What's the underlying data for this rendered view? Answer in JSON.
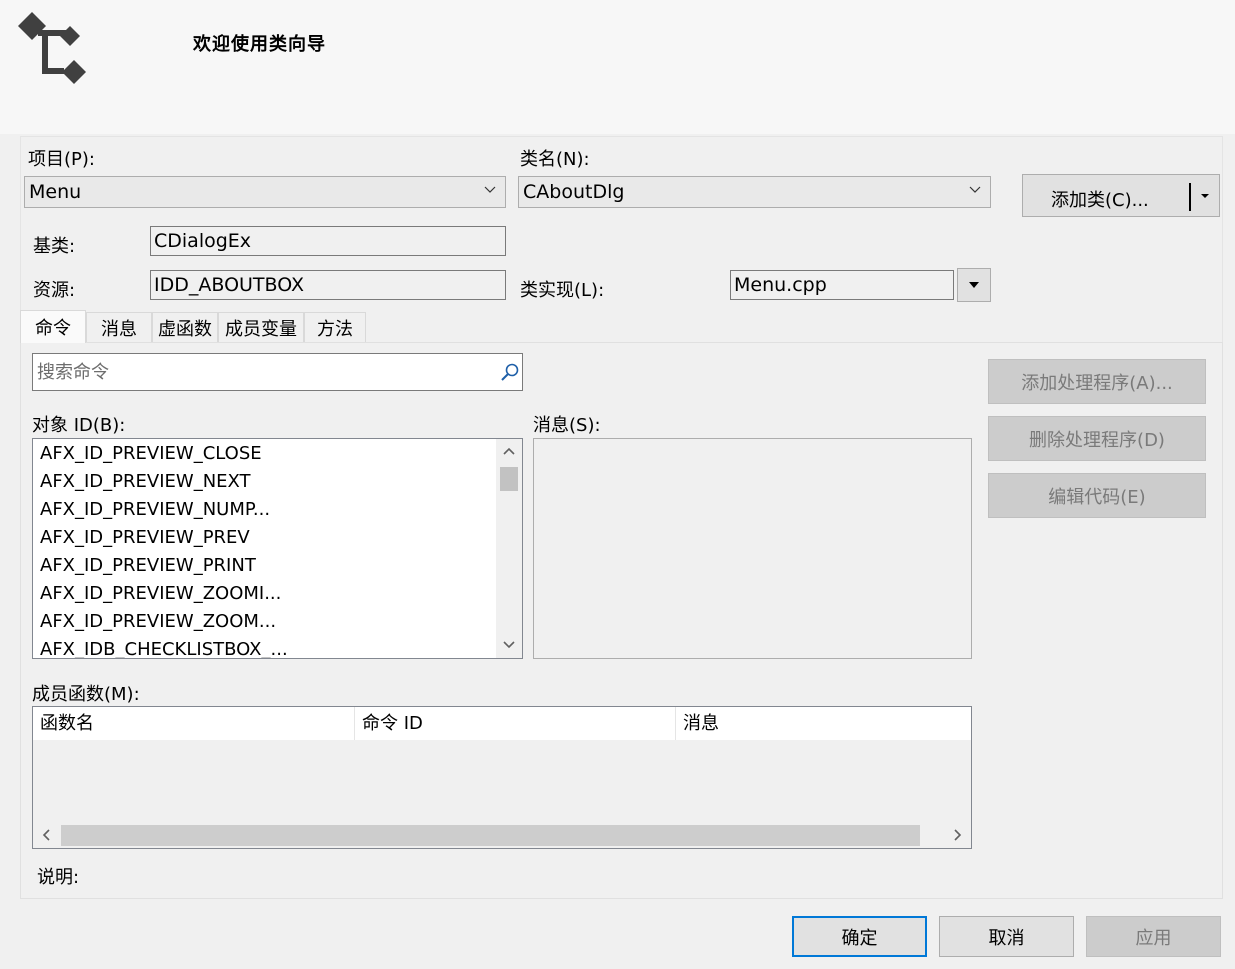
{
  "header": {
    "title": "欢迎使用类向导",
    "logo": "class-wizard-logo-icon"
  },
  "project": {
    "label": "项目(P):",
    "value": "Menu"
  },
  "class_name": {
    "label": "类名(N):",
    "value": "CAboutDlg"
  },
  "add_class_button": "添加类(C)...",
  "base_class": {
    "label": "基类:",
    "value": "CDialogEx"
  },
  "resource": {
    "label": "资源:",
    "value": "IDD_ABOUTBOX"
  },
  "class_impl": {
    "label": "类实现(L):",
    "value": "Menu.cpp"
  },
  "tabs": [
    {
      "label": "命令",
      "active": true
    },
    {
      "label": "消息",
      "active": false
    },
    {
      "label": "虚函数",
      "active": false
    },
    {
      "label": "成员变量",
      "active": false
    },
    {
      "label": "方法",
      "active": false
    }
  ],
  "search": {
    "placeholder": "搜索命令"
  },
  "object_ids": {
    "label": "对象 ID(B):",
    "items": [
      "AFX_ID_PREVIEW_CLOSE",
      "AFX_ID_PREVIEW_NEXT",
      "AFX_ID_PREVIEW_NUMP...",
      "AFX_ID_PREVIEW_PREV",
      "AFX_ID_PREVIEW_PRINT",
      "AFX_ID_PREVIEW_ZOOMI...",
      "AFX_ID_PREVIEW_ZOOM...",
      "AFX_IDB_CHECKLISTBOX_..."
    ]
  },
  "messages": {
    "label": "消息(S):"
  },
  "action_buttons": {
    "add_handler": "添加处理程序(A)...",
    "delete_handler": "删除处理程序(D)",
    "edit_code": "编辑代码(E)"
  },
  "member_functions": {
    "label": "成员函数(M):",
    "columns": [
      "函数名",
      "命令 ID",
      "消息"
    ]
  },
  "description": {
    "label": "说明:"
  },
  "footer": {
    "ok": "确定",
    "cancel": "取消",
    "apply": "应用"
  }
}
